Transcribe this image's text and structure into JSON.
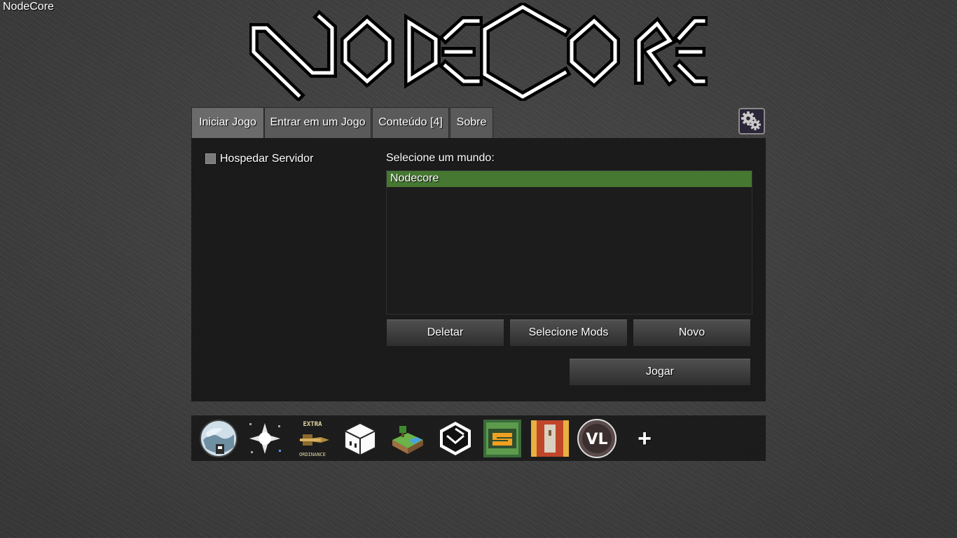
{
  "window": {
    "title": "NodeCore"
  },
  "logo": {
    "icon": "nodecore-logo"
  },
  "tabs": [
    {
      "label": "Iniciar Jogo",
      "active": true
    },
    {
      "label": "Entrar em um Jogo",
      "active": false
    },
    {
      "label": "Conteúdo [4]",
      "active": false
    },
    {
      "label": "Sobre",
      "active": false
    }
  ],
  "settings": {
    "icon": "gears-icon"
  },
  "host_server": {
    "label": "Hospedar Servidor",
    "checked": false
  },
  "world_select": {
    "label": "Selecione um mundo:",
    "worlds": [
      "Nodecore"
    ],
    "selected": "Nodecore"
  },
  "buttons": {
    "delete": "Deletar",
    "select_mods": "Selecione Mods",
    "new": "Novo",
    "play": "Jogar"
  },
  "games": [
    {
      "icon": "globe-game-icon"
    },
    {
      "icon": "sparkle-game-icon"
    },
    {
      "icon": "extra-ordinance-game-icon",
      "text_top": "EXTRA",
      "text_bottom": "ORDINANCE"
    },
    {
      "icon": "cube-face-game-icon"
    },
    {
      "icon": "grass-island-game-icon"
    },
    {
      "icon": "nodecore-hexagon-game-icon"
    },
    {
      "icon": "s-block-game-icon"
    },
    {
      "icon": "book-game-icon"
    },
    {
      "icon": "vl-badge-game-icon",
      "text": "VL"
    }
  ],
  "add_content": {
    "label": "+"
  },
  "colors": {
    "selected_world": "#467832",
    "panel": "#121212"
  }
}
